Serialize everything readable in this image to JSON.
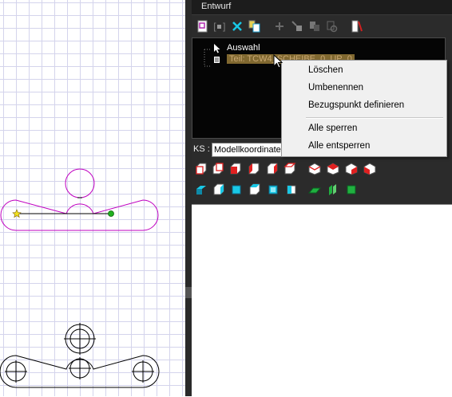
{
  "panel": {
    "title": "Entwurf"
  },
  "toolbar": {
    "buttons": [
      {
        "icon": "new-part-icon"
      },
      {
        "icon": "group-icon"
      },
      {
        "icon": "delete-x-icon",
        "color": "#19c8e6"
      },
      {
        "icon": "copy-icon"
      },
      {
        "icon": "add-icon"
      },
      {
        "icon": "assign-icon"
      },
      {
        "icon": "transfer-icon"
      },
      {
        "icon": "refresh-icon"
      },
      {
        "icon": "properties-icon"
      }
    ]
  },
  "tree": {
    "items": [
      {
        "label": "Auswahl",
        "icon": "cursor-arrow-icon"
      },
      {
        "label": "Teil: TCW4_SCHEIBE_0_UP_0",
        "icon": "part-list-icon",
        "selected": true
      }
    ]
  },
  "ks": {
    "label": "KS :",
    "value": "Modellkoordinaten"
  },
  "context_menu": {
    "items": [
      {
        "label": "Löschen"
      },
      {
        "label": "Umbenennen"
      },
      {
        "label": "Bezugspunkt definieren"
      },
      {
        "label": "Alle sperren"
      },
      {
        "label": "Alle entsperren"
      }
    ]
  },
  "colors": {
    "selection_outline": "#c000c0",
    "snap_point_yellow": "#f0e020",
    "snap_point_green": "#20b020",
    "panel_bg": "#2b2b2b",
    "tree_bg": "#050505",
    "accent_cyan": "#19c8e6",
    "accent_red": "#e02020"
  }
}
